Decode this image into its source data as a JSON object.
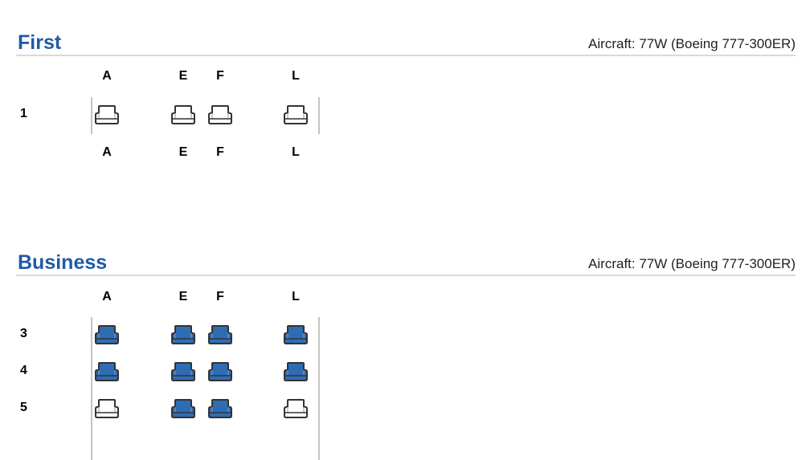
{
  "colors": {
    "accent": "#1f5ba6",
    "occupied": "#2e6db4",
    "available": "#ffffff",
    "seat_outline": "#333333"
  },
  "sections": [
    {
      "title": "First",
      "aircraft": "Aircraft: 77W (Boeing 777-300ER)",
      "columns": [
        "A",
        "E",
        "F",
        "L"
      ],
      "rows": [
        {
          "label": "1",
          "seats": [
            {
              "col": "A",
              "status": "available"
            },
            {
              "col": "E",
              "status": "available"
            },
            {
              "col": "F",
              "status": "available"
            },
            {
              "col": "L",
              "status": "available"
            }
          ]
        }
      ]
    },
    {
      "title": "Business",
      "aircraft": "Aircraft: 77W (Boeing 777-300ER)",
      "columns": [
        "A",
        "E",
        "F",
        "L"
      ],
      "rows": [
        {
          "label": "3",
          "seats": [
            {
              "col": "A",
              "status": "occupied"
            },
            {
              "col": "E",
              "status": "occupied"
            },
            {
              "col": "F",
              "status": "occupied"
            },
            {
              "col": "L",
              "status": "occupied"
            }
          ]
        },
        {
          "label": "4",
          "seats": [
            {
              "col": "A",
              "status": "occupied"
            },
            {
              "col": "E",
              "status": "occupied"
            },
            {
              "col": "F",
              "status": "occupied"
            },
            {
              "col": "L",
              "status": "occupied"
            }
          ]
        },
        {
          "label": "5",
          "seats": [
            {
              "col": "A",
              "status": "available"
            },
            {
              "col": "E",
              "status": "occupied"
            },
            {
              "col": "F",
              "status": "occupied"
            },
            {
              "col": "L",
              "status": "available"
            }
          ]
        }
      ]
    }
  ]
}
